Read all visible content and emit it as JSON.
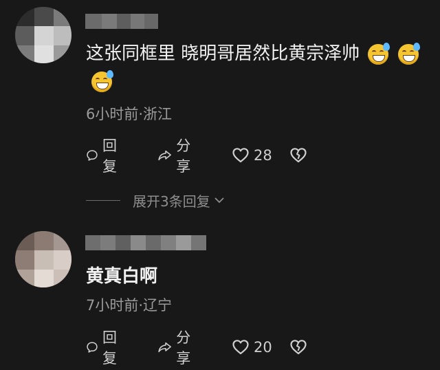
{
  "comments": [
    {
      "text": "这张同框里 晓明哥居然比黄宗泽帅",
      "meta": "6小时前·浙江",
      "reply_label": "回复",
      "share_label": "分享",
      "like_count": "28",
      "expand_label": "展开3条回复",
      "emoji_count": 3,
      "icons": [
        "reply-icon",
        "share-icon",
        "heart-icon",
        "broken-heart-icon",
        "grinning-sweat-emoji"
      ]
    },
    {
      "text": "黄真白啊",
      "meta": "7小时前·辽宁",
      "reply_label": "回复",
      "share_label": "分享",
      "like_count": "20",
      "icons": [
        "reply-icon",
        "share-icon",
        "heart-icon",
        "broken-heart-icon"
      ]
    }
  ],
  "colors": {
    "background": "#181818",
    "text": "#f2f2f2",
    "meta": "#9b9b9b",
    "emoji": "#f4c431"
  }
}
